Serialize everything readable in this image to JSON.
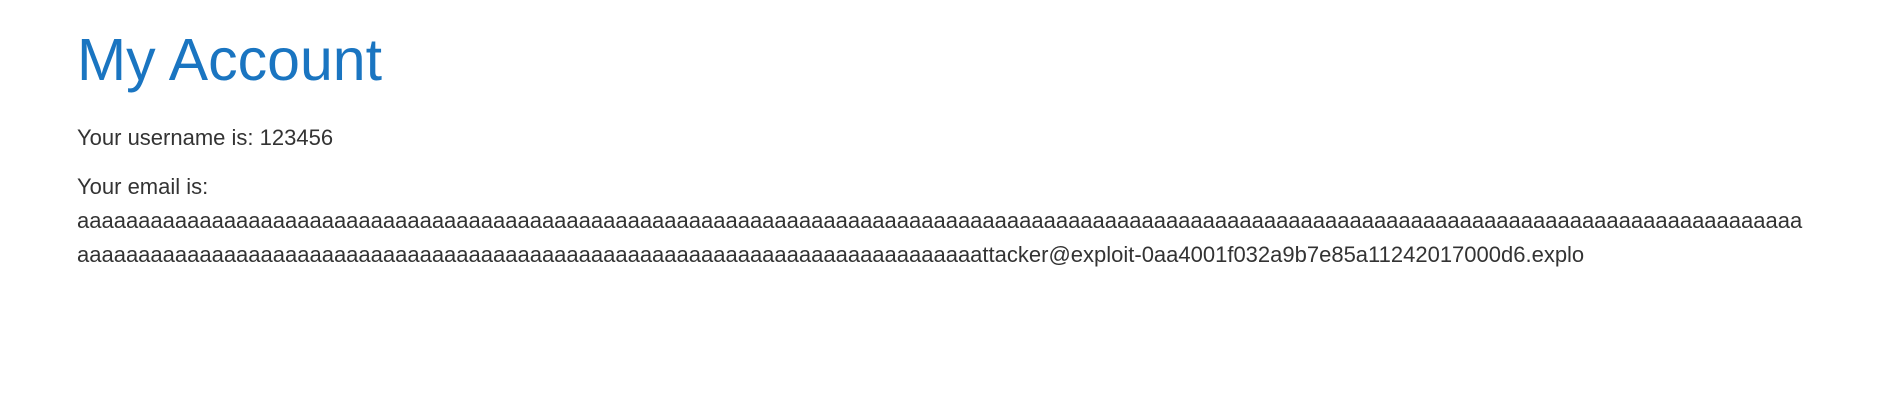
{
  "account": {
    "title": "My Account",
    "username_label": "Your username is:",
    "username": "123456",
    "email_label": "Your email is:",
    "email": "aaaaaaaaaaaaaaaaaaaaaaaaaaaaaaaaaaaaaaaaaaaaaaaaaaaaaaaaaaaaaaaaaaaaaaaaaaaaaaaaaaaaaaaaaaaaaaaaaaaaaaaaaaaaaaaaaaaaaaaaaaaaaaaaaaaaaaaaaaaaaaaaaaaaaaaaaaaaaaaaaaaaaaaaaaaaaaaaaaaaaaaaaaaaaaaaaaaaaaaaaaaaaaaaaaaaaaattacker@exploit-0aa4001f032a9b7e85a11242017000d6.explo"
  },
  "colors": {
    "title": "#1a75c1",
    "text": "#333333",
    "background": "#ffffff"
  }
}
